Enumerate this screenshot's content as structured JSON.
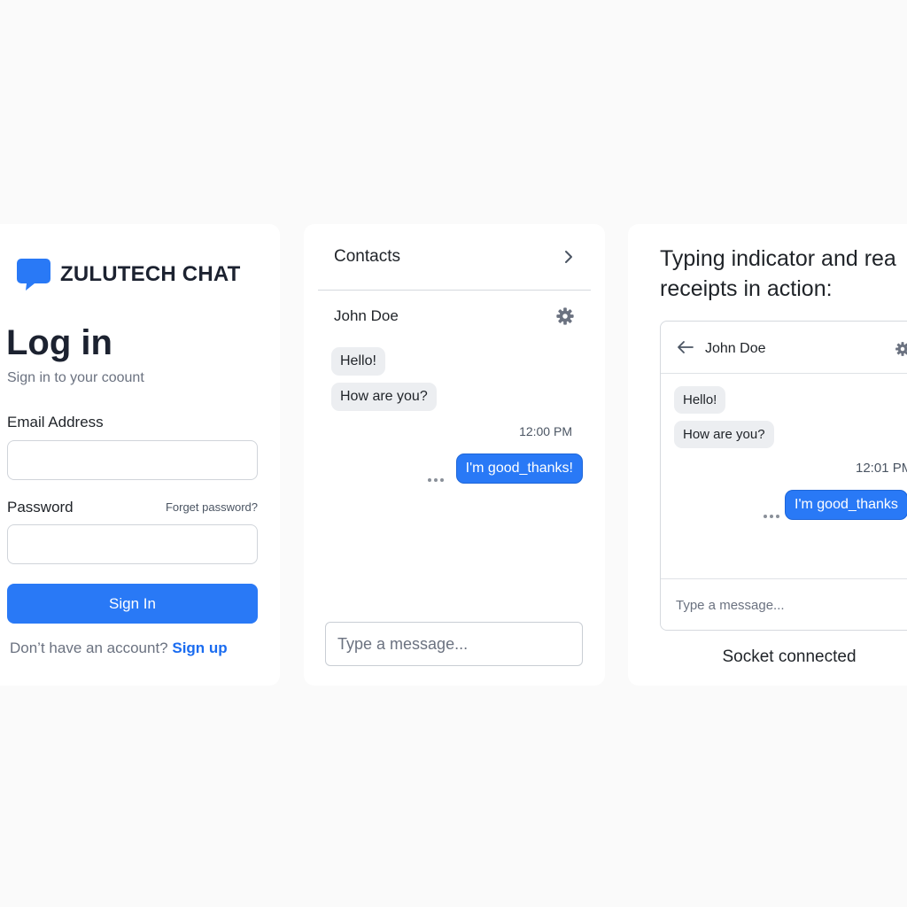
{
  "colors": {
    "accent": "#2979f6",
    "link": "#1a6cf0",
    "background": "#fafafa",
    "incoming_bubble": "#eceef1"
  },
  "login": {
    "brand_name": "ZULUTECH CHAT",
    "brand_icon": "chat-bubble-icon",
    "title": "Log in",
    "subtitle": "Sign in to your coount",
    "email_label": "Email Address",
    "email_value": "",
    "password_label": "Password",
    "password_value": "",
    "forgot_label": "Forget password?",
    "signin_label": "Sign In",
    "signup_prompt": "Don’t have an account?",
    "signup_link": "Sign up"
  },
  "chat": {
    "contacts_title": "Contacts",
    "contacts_icon": "chevron-right-icon",
    "contact_name": "John Doe",
    "settings_icon": "gear-icon",
    "messages_in": [
      "Hello!",
      "How are you?"
    ],
    "timestamp": "12:00 PM",
    "message_out": "I'm good_thanks!",
    "input_placeholder": "Type a message..."
  },
  "demo": {
    "caption_line1": "Typing indicator and rea",
    "caption_line2": "receipts in action:",
    "back_icon": "arrow-left-icon",
    "contact_name": "John Doe",
    "messages_in": [
      "Hello!",
      "How are you?"
    ],
    "timestamp": "12:01 PM",
    "message_out": "I'm good_thanks",
    "input_placeholder": "Type a message...",
    "status": "Socket connected"
  }
}
